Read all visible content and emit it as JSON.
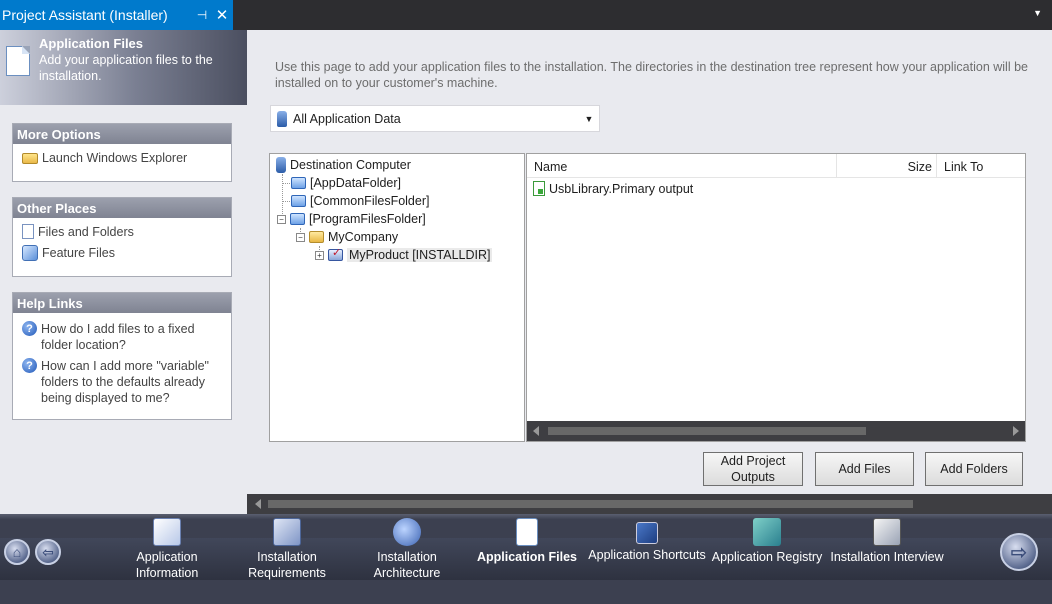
{
  "tab": {
    "title": "Project Assistant (Installer)",
    "pin": "⊣",
    "close": "✕",
    "menu": "▼"
  },
  "sidebar": {
    "header": {
      "title": "Application Files",
      "description": "Add your application files to the installation."
    },
    "more_options": {
      "title": "More Options",
      "items": [
        "Launch Windows Explorer"
      ]
    },
    "other_places": {
      "title": "Other Places",
      "items": [
        "Files and Folders",
        "Feature Files"
      ]
    },
    "help_links": {
      "title": "Help Links",
      "items": [
        "How do I add files to a fixed folder location?",
        "How can I add more \"variable\" folders to the defaults already being displayed to me?"
      ]
    }
  },
  "main": {
    "intro": "Use this page to add your application files to the installation. The directories in the destination tree represent how your application will be installed on to your customer's machine.",
    "filter": {
      "value": "All Application Data"
    },
    "tree": {
      "root": "Destination Computer",
      "nodes": [
        "[AppDataFolder]",
        "[CommonFilesFolder]",
        "[ProgramFilesFolder]",
        "MyCompany",
        "MyProduct [INSTALLDIR]"
      ]
    },
    "list": {
      "columns": [
        "Name",
        "Size",
        "Link To"
      ],
      "rows": [
        {
          "name": "UsbLibrary.Primary output",
          "size": "",
          "link": ""
        }
      ]
    },
    "buttons": {
      "add_project_outputs": "Add Project Outputs",
      "add_files": "Add Files",
      "add_folders": "Add Folders"
    }
  },
  "nav": {
    "items": [
      {
        "label": "Application Information",
        "icon": "application-information-icon"
      },
      {
        "label": "Installation Requirements",
        "icon": "installation-requirements-icon"
      },
      {
        "label": "Installation Architecture",
        "icon": "installation-architecture-icon"
      },
      {
        "label": "Application Files",
        "icon": "application-files-icon",
        "active": true
      },
      {
        "label": "Application Shortcuts",
        "icon": "application-shortcuts-icon"
      },
      {
        "label": "Application Registry",
        "icon": "application-registry-icon"
      },
      {
        "label": "Installation Interview",
        "icon": "installation-interview-icon"
      }
    ]
  }
}
